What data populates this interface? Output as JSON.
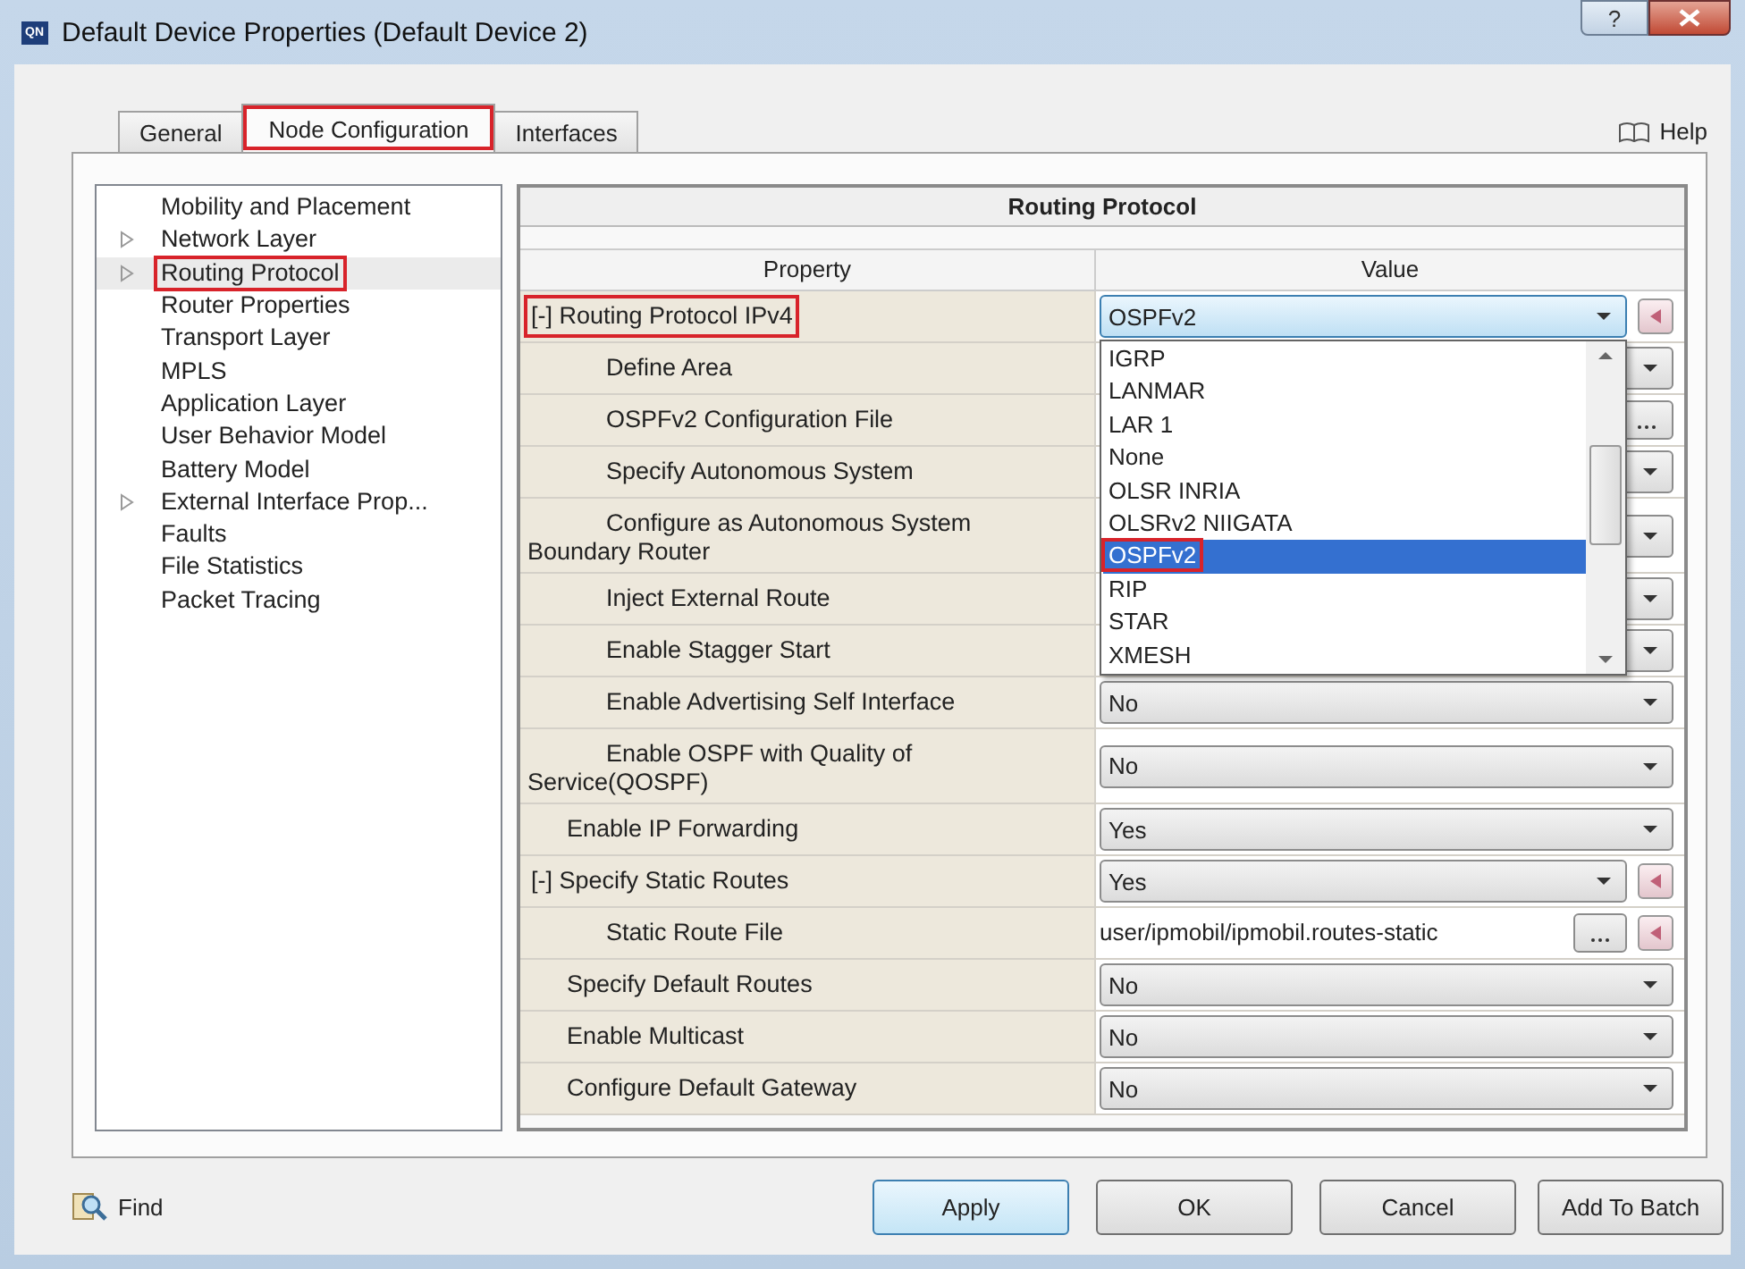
{
  "window": {
    "logo": "QN",
    "title": "Default Device Properties (Default Device 2)",
    "help_glyph": "?"
  },
  "tabs": [
    {
      "label": "General",
      "selected": false,
      "highlighted": false
    },
    {
      "label": "Node Configuration",
      "selected": true,
      "highlighted": true
    },
    {
      "label": "Interfaces",
      "selected": false,
      "highlighted": false
    }
  ],
  "help": "Help",
  "tree": [
    {
      "label": "Mobility and Placement",
      "expandable": false,
      "selected": false,
      "highlighted": false
    },
    {
      "label": "Network Layer",
      "expandable": true,
      "selected": false,
      "highlighted": false
    },
    {
      "label": "Routing Protocol",
      "expandable": true,
      "selected": true,
      "highlighted": true
    },
    {
      "label": "Router Properties",
      "expandable": false,
      "selected": false,
      "highlighted": false
    },
    {
      "label": "Transport Layer",
      "expandable": false,
      "selected": false,
      "highlighted": false
    },
    {
      "label": "MPLS",
      "expandable": false,
      "selected": false,
      "highlighted": false
    },
    {
      "label": "Application Layer",
      "expandable": false,
      "selected": false,
      "highlighted": false
    },
    {
      "label": "User Behavior Model",
      "expandable": false,
      "selected": false,
      "highlighted": false
    },
    {
      "label": "Battery Model",
      "expandable": false,
      "selected": false,
      "highlighted": false
    },
    {
      "label": "External Interface Prop...",
      "expandable": true,
      "selected": false,
      "highlighted": false
    },
    {
      "label": "Faults",
      "expandable": false,
      "selected": false,
      "highlighted": false
    },
    {
      "label": "File Statistics",
      "expandable": false,
      "selected": false,
      "highlighted": false
    },
    {
      "label": "Packet Tracing",
      "expandable": false,
      "selected": false,
      "highlighted": false
    }
  ],
  "table": {
    "title": "Routing Protocol",
    "columns": [
      "Property",
      "Value"
    ],
    "rows": [
      {
        "toggle": "[-]",
        "label": "Routing Protocol IPv4",
        "highlighted": true,
        "kind": "combo",
        "value": "OSPFv2",
        "reset": true,
        "expanded": true,
        "options": [
          {
            "label": "IGRP",
            "selected": false,
            "highlighted": false
          },
          {
            "label": "LANMAR",
            "selected": false,
            "highlighted": false
          },
          {
            "label": "LAR 1",
            "selected": false,
            "highlighted": false
          },
          {
            "label": "None",
            "selected": false,
            "highlighted": false
          },
          {
            "label": "OLSR INRIA",
            "selected": false,
            "highlighted": false
          },
          {
            "label": "OLSRv2 NIIGATA",
            "selected": false,
            "highlighted": false
          },
          {
            "label": "OSPFv2",
            "selected": true,
            "highlighted": true
          },
          {
            "label": "RIP",
            "selected": false,
            "highlighted": false
          },
          {
            "label": "STAR",
            "selected": false,
            "highlighted": false
          },
          {
            "label": "XMESH",
            "selected": false,
            "highlighted": false
          }
        ],
        "children": [
          {
            "label": "Define Area",
            "kind": "combo"
          },
          {
            "label": "OSPFv2 Configuration File",
            "kind": "file"
          },
          {
            "label": "Specify Autonomous System",
            "kind": "combo"
          },
          {
            "label": "Configure as Autonomous System Boundary Router",
            "kind": "combo"
          },
          {
            "label": "Inject External Route",
            "kind": "combo"
          },
          {
            "label": "Enable Stagger Start",
            "kind": "combo"
          },
          {
            "label": "Enable Advertising Self Interface",
            "kind": "combo",
            "value": "No"
          },
          {
            "label": "Enable OSPF with Quality of Service(QOSPF)",
            "kind": "combo",
            "value": "No"
          }
        ]
      },
      {
        "label": "Enable IP Forwarding",
        "kind": "combo",
        "value": "Yes"
      },
      {
        "toggle": "[-]",
        "label": "Specify Static Routes",
        "kind": "combo",
        "value": "Yes",
        "reset": true,
        "children": [
          {
            "label": "Static Route File",
            "kind": "file",
            "value": "user/ipmobil/ipmobil.routes-static",
            "reset": true
          }
        ]
      },
      {
        "label": "Specify Default Routes",
        "kind": "combo",
        "value": "No"
      },
      {
        "label": "Enable Multicast",
        "kind": "combo",
        "value": "No"
      },
      {
        "label": "Configure Default Gateway",
        "kind": "combo",
        "value": "No"
      }
    ]
  },
  "find": "Find",
  "buttons": [
    {
      "label": "Apply",
      "default": true
    },
    {
      "label": "OK",
      "default": false
    },
    {
      "label": "Cancel",
      "default": false
    },
    {
      "label": "Add To Batch",
      "default": false
    }
  ]
}
